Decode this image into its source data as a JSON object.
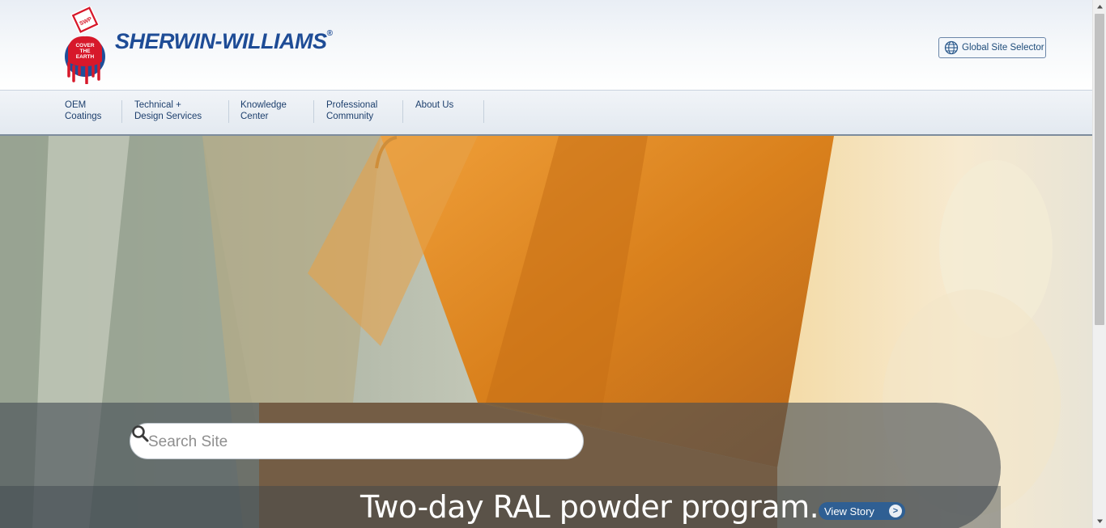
{
  "brand": {
    "name": "SHERWIN-WILLIAMS",
    "registered_mark": "®",
    "logo_text": "COVER THE EARTH",
    "logo_monogram": "SWP",
    "brand_blue": "#1e4c96",
    "brand_red": "#d7182a"
  },
  "header": {
    "global_selector_label": "Global Site Selector",
    "global_icon": "globe-icon"
  },
  "nav": {
    "items": [
      {
        "label": "OEM\nCoatings"
      },
      {
        "label": "Technical +\nDesign Services"
      },
      {
        "label": "Knowledge\nCenter"
      },
      {
        "label": "Professional\nCommunity"
      },
      {
        "label": "About Us"
      }
    ]
  },
  "search": {
    "placeholder": "Search Site",
    "icon": "search-icon"
  },
  "hero": {
    "headline": "Two-day RAL powder program.",
    "cta_label": "View Story",
    "cta_icon": "chevron-right-icon",
    "cta_arrow": ">"
  },
  "scrollbar": {
    "up_icon": "scroll-up-arrow-icon",
    "down_icon": "scroll-down-arrow-icon"
  }
}
